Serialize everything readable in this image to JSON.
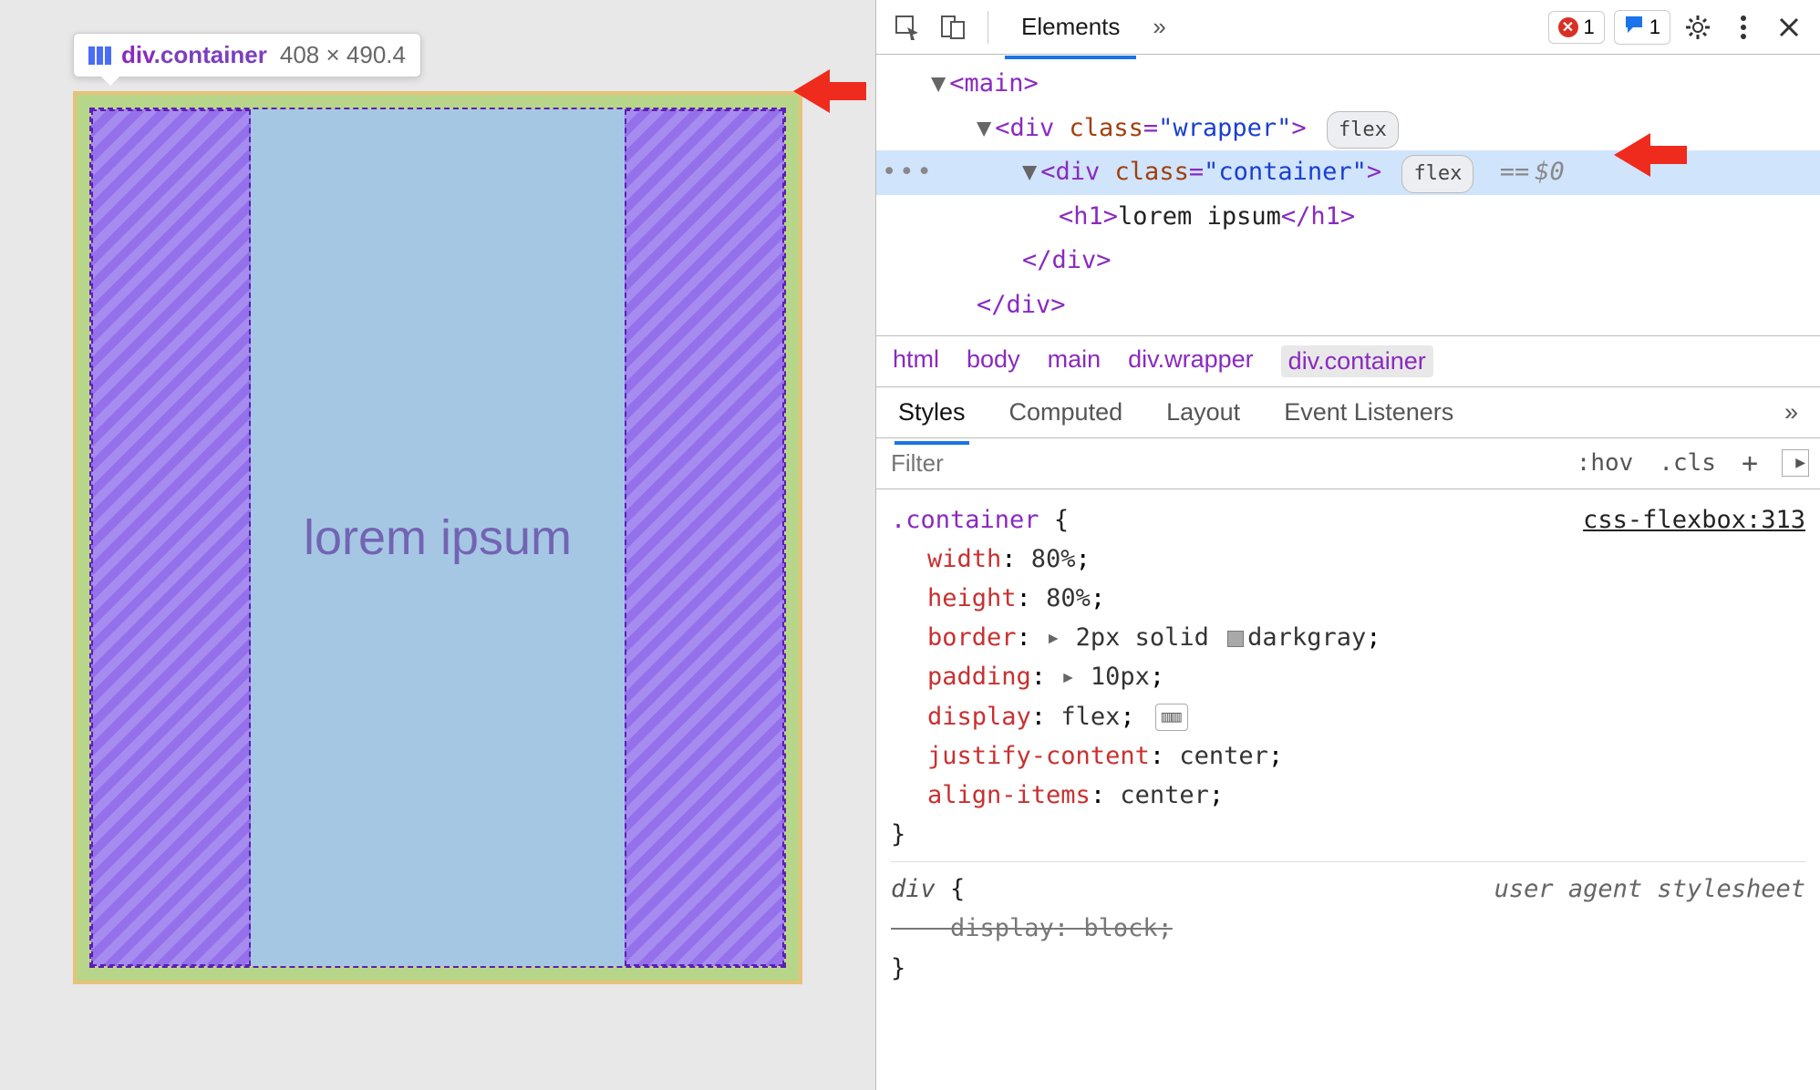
{
  "viewport": {
    "tooltip": {
      "element_tag": "div",
      "element_class": ".container",
      "dimensions": "408 × 490.4"
    },
    "content_text": "lorem ipsum"
  },
  "devtools": {
    "toolbar": {
      "tab_elements": "Elements",
      "tabs_more": "»",
      "errors_count": "1",
      "messages_count": "1"
    },
    "dom": {
      "n_main_open": "<main>",
      "n_wrapper_open_pre": "<div ",
      "n_wrapper_attr_n": "class",
      "n_wrapper_attr_v": "\"wrapper\"",
      "n_wrapper_open_post": ">",
      "flex_badge": "flex",
      "n_container_open_pre": "<div ",
      "n_container_attr_n": "class",
      "n_container_attr_v": "\"container\"",
      "n_container_open_post": ">",
      "eq": "==",
      "dollar": "$0",
      "n_h1_open": "<h1>",
      "n_h1_text": "lorem ipsum",
      "n_h1_close": "</h1>",
      "n_div_close1": "</div>",
      "n_div_close2": "</div>"
    },
    "breadcrumbs": [
      "html",
      "body",
      "main",
      "div.wrapper",
      "div.container"
    ],
    "styles_tabs": {
      "styles": "Styles",
      "computed": "Computed",
      "layout": "Layout",
      "event_listeners": "Event Listeners",
      "more": "»"
    },
    "filter": {
      "placeholder": "Filter",
      "hov": ":hov",
      "cls": ".cls"
    },
    "rules": {
      "r1": {
        "source": "css-flexbox:313",
        "selector": ".container",
        "decls": [
          {
            "prop": "width",
            "val": "80%"
          },
          {
            "prop": "height",
            "val": "80%"
          },
          {
            "prop": "border",
            "val_pre": "2px solid",
            "val_color": "darkgray",
            "expand": true,
            "swatch": true
          },
          {
            "prop": "padding",
            "val": "10px",
            "expand": true
          },
          {
            "prop": "display",
            "val": "flex",
            "flexbtn": true
          },
          {
            "prop": "justify-content",
            "val": "center"
          },
          {
            "prop": "align-items",
            "val": "center"
          }
        ]
      },
      "r2": {
        "source": "user agent stylesheet",
        "selector": "div",
        "decls": [
          {
            "prop": "display",
            "val": "block",
            "strike": true
          }
        ]
      }
    }
  }
}
